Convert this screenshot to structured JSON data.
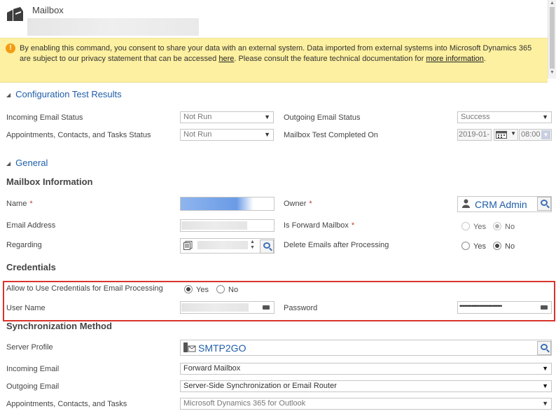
{
  "header": {
    "title": "Mailbox"
  },
  "notification": {
    "icon": "warning-icon",
    "text_prefix": "By enabling this command, you consent to share your data with an external system. Data imported from external systems into Microsoft Dynamics 365 are subject to our privacy statement that can be accessed ",
    "link_here": "here",
    "text_middle": ". Please consult the feature technical documentation for ",
    "link_more": "more information",
    "text_suffix": "."
  },
  "config_section": {
    "title": "Configuration Test Results",
    "incoming_label": "Incoming Email Status",
    "incoming_value": "Not Run",
    "outgoing_label": "Outgoing Email Status",
    "outgoing_value": "Success",
    "appointments_label": "Appointments, Contacts, and Tasks Status",
    "appointments_value": "Not Run",
    "completed_label": "Mailbox Test Completed On",
    "completed_date": "2019-01-",
    "completed_time": "08:00"
  },
  "general_section": {
    "title": "General",
    "mailbox_info_title": "Mailbox Information",
    "name_label": "Name",
    "owner_label": "Owner",
    "owner_value": "CRM Admin",
    "email_label": "Email Address",
    "forward_label": "Is Forward Mailbox",
    "forward_yes": "Yes",
    "forward_no": "No",
    "regarding_label": "Regarding",
    "delete_label": "Delete Emails after Processing",
    "delete_yes": "Yes",
    "delete_no": "No"
  },
  "credentials": {
    "title": "Credentials",
    "allow_label": "Allow to Use Credentials for Email Processing",
    "allow_yes": "Yes",
    "allow_no": "No",
    "username_label": "User Name",
    "password_label": "Password",
    "password_mask": "••••••••••••••••••••••••••••"
  },
  "sync": {
    "title": "Synchronization Method",
    "server_profile_label": "Server Profile",
    "server_profile_value": "SMTP2GO",
    "incoming_label": "Incoming Email",
    "incoming_value": "Forward Mailbox",
    "outgoing_label": "Outgoing Email",
    "outgoing_value": "Server-Side Synchronization or Email Router",
    "act_label": "Appointments, Contacts, and Tasks",
    "act_value": "Microsoft Dynamics 365 for Outlook"
  },
  "colors": {
    "accent": "#1f5ea8",
    "notification_bg": "#fdf0a0",
    "highlight": "#d9342b"
  }
}
